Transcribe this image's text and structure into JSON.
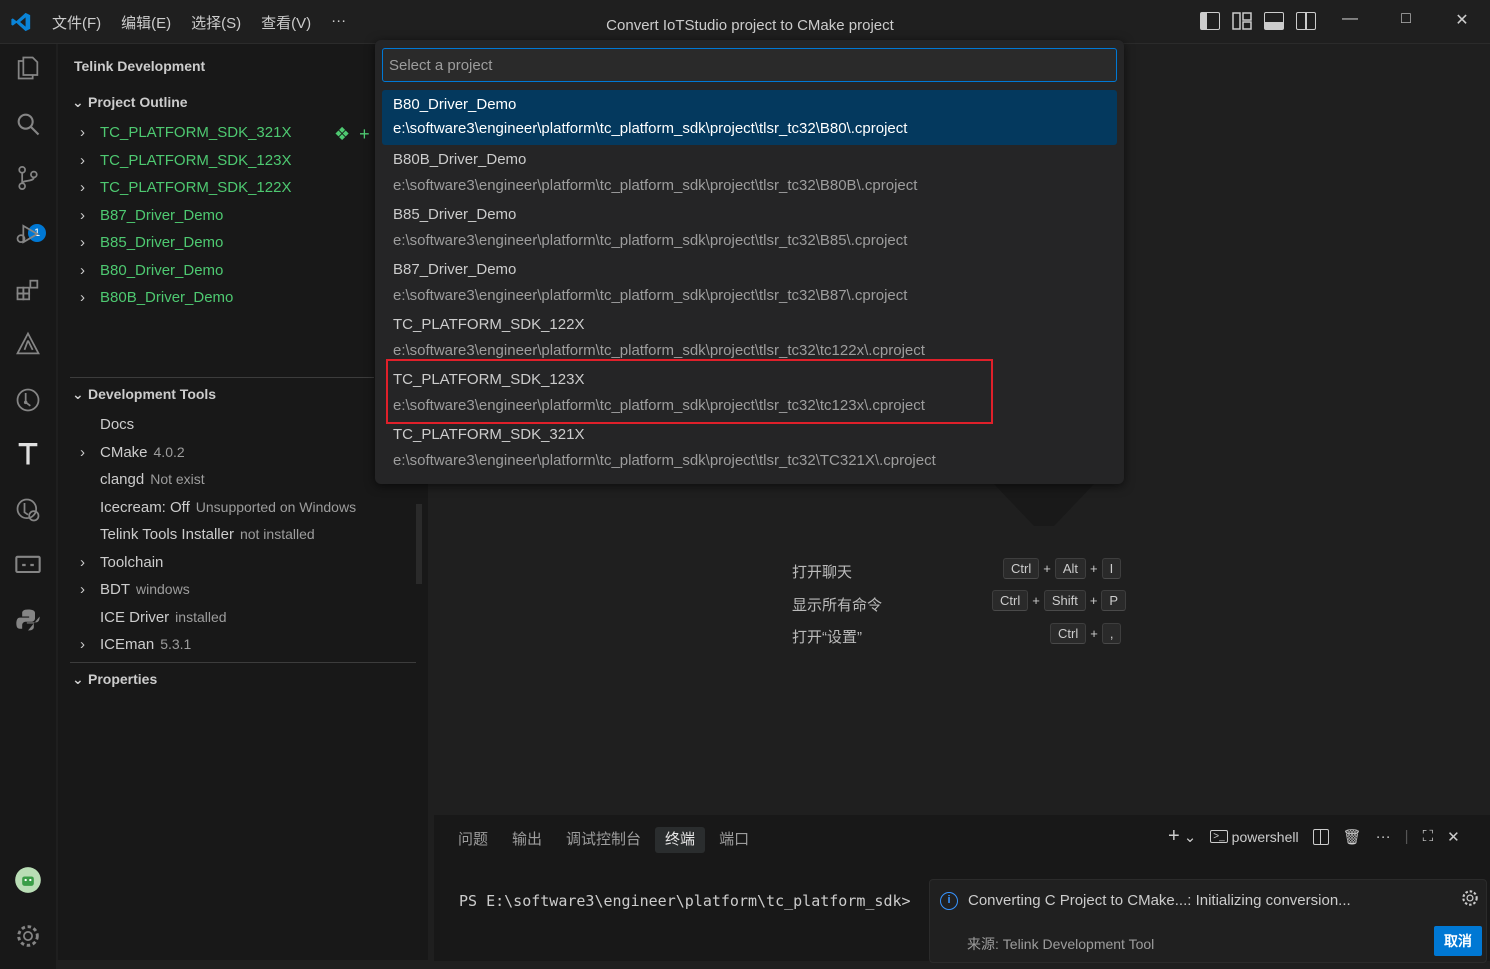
{
  "titlebar": {
    "menu": [
      "文件(F)",
      "编辑(E)",
      "选择(S)",
      "查看(V)",
      "···"
    ],
    "title": "Convert IoTStudio project to CMake project"
  },
  "activity": {
    "badge_count": "1"
  },
  "sidebar": {
    "header": "Telink Development",
    "project_outline": {
      "title": "Project Outline",
      "items": [
        {
          "label": "TC_PLATFORM_SDK_321X"
        },
        {
          "label": "TC_PLATFORM_SDK_123X"
        },
        {
          "label": "TC_PLATFORM_SDK_122X"
        },
        {
          "label": "B87_Driver_Demo"
        },
        {
          "label": "B85_Driver_Demo"
        },
        {
          "label": "B80_Driver_Demo"
        },
        {
          "label": "B80B_Driver_Demo"
        }
      ]
    },
    "dev_tools": {
      "title": "Development Tools",
      "items": [
        {
          "label": "Docs",
          "desc": ""
        },
        {
          "label": "CMake",
          "desc": "4.0.2"
        },
        {
          "label": "clangd",
          "desc": "Not exist"
        },
        {
          "label": "Icecream: Off",
          "desc": "Unsupported on Windows"
        },
        {
          "label": "Telink Tools Installer",
          "desc": "not installed"
        },
        {
          "label": "Toolchain",
          "desc": ""
        },
        {
          "label": "BDT",
          "desc": "windows"
        },
        {
          "label": "ICE Driver",
          "desc": "installed"
        },
        {
          "label": "ICEman",
          "desc": "5.3.1"
        }
      ]
    },
    "properties": {
      "title": "Properties"
    }
  },
  "quickpick": {
    "placeholder": "Select a project",
    "items": [
      {
        "label": "B80_Driver_Demo",
        "desc": "e:\\software3\\engineer\\platform\\tc_platform_sdk\\project\\tlsr_tc32\\B80\\.cproject"
      },
      {
        "label": "B80B_Driver_Demo",
        "desc": "e:\\software3\\engineer\\platform\\tc_platform_sdk\\project\\tlsr_tc32\\B80B\\.cproject"
      },
      {
        "label": "B85_Driver_Demo",
        "desc": "e:\\software3\\engineer\\platform\\tc_platform_sdk\\project\\tlsr_tc32\\B85\\.cproject"
      },
      {
        "label": "B87_Driver_Demo",
        "desc": "e:\\software3\\engineer\\platform\\tc_platform_sdk\\project\\tlsr_tc32\\B87\\.cproject"
      },
      {
        "label": "TC_PLATFORM_SDK_122X",
        "desc": "e:\\software3\\engineer\\platform\\tc_platform_sdk\\project\\tlsr_tc32\\tc122x\\.cproject"
      },
      {
        "label": "TC_PLATFORM_SDK_123X",
        "desc": "e:\\software3\\engineer\\platform\\tc_platform_sdk\\project\\tlsr_tc32\\tc123x\\.cproject"
      },
      {
        "label": "TC_PLATFORM_SDK_321X",
        "desc": "e:\\software3\\engineer\\platform\\tc_platform_sdk\\project\\tlsr_tc32\\TC321X\\.cproject"
      }
    ]
  },
  "shortcuts": [
    {
      "label": "打开聊天",
      "keys": [
        "Ctrl",
        "Alt",
        "I"
      ]
    },
    {
      "label": "显示所有命令",
      "keys": [
        "Ctrl",
        "Shift",
        "P"
      ]
    },
    {
      "label": "打开“设置”",
      "keys": [
        "Ctrl",
        ","
      ]
    }
  ],
  "panel": {
    "tabs": [
      "问题",
      "输出",
      "调试控制台",
      "终端",
      "端口"
    ],
    "active_tab": "终端",
    "shell": "powershell",
    "terminal_line": "PS E:\\software3\\engineer\\platform\\tc_platform_sdk>"
  },
  "notification": {
    "message": "Converting C Project to CMake...: Initializing conversion...",
    "source": "来源: Telink Development Tool",
    "button": "取消"
  },
  "colors": {
    "accent": "#0078d4",
    "selection": "#04395e",
    "tree_green": "#4ec971",
    "highlight": "#e0202a"
  }
}
